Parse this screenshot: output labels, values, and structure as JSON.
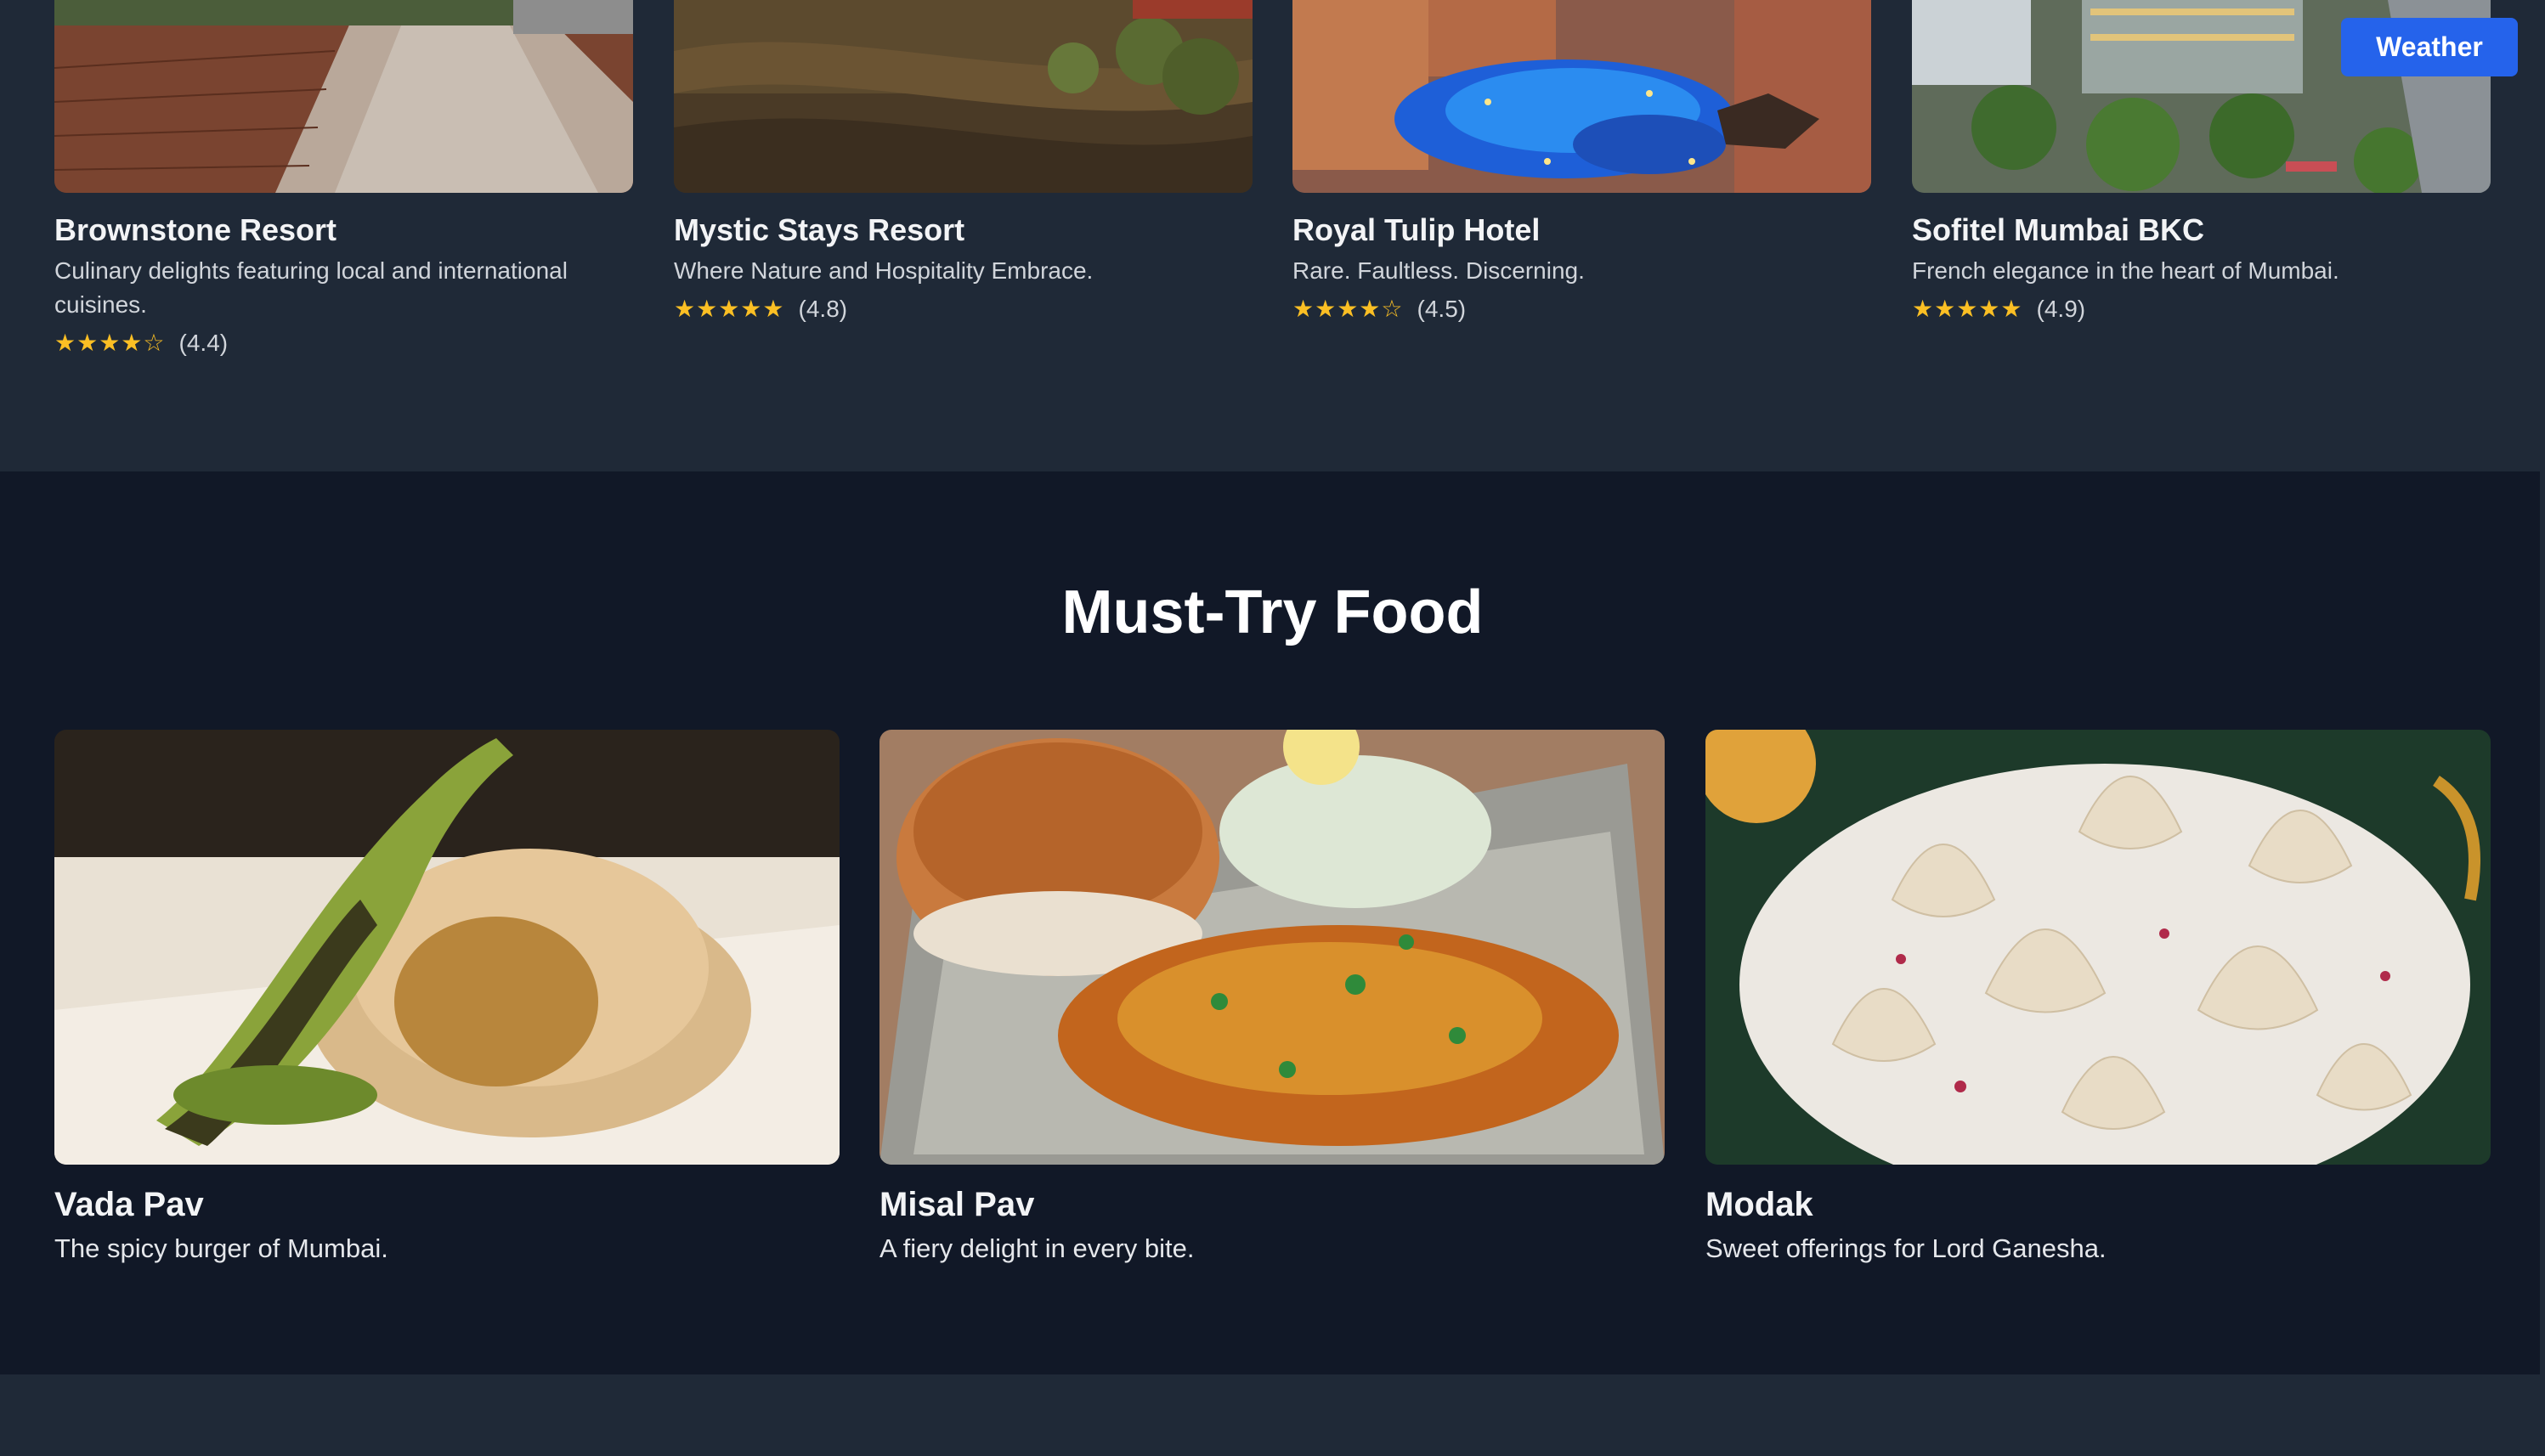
{
  "weather_button": {
    "label": "Weather"
  },
  "stays": [
    {
      "name": "Brownstone Resort",
      "description": "Culinary delights featuring local and international cuisines.",
      "stars": "★★★★☆",
      "rating": "(4.4)",
      "rating_value": 4.4
    },
    {
      "name": "Mystic Stays Resort",
      "description": "Where Nature and Hospitality Embrace.",
      "stars": "★★★★★",
      "rating": "(4.8)",
      "rating_value": 4.8
    },
    {
      "name": "Royal Tulip Hotel",
      "description": "Rare. Faultless. Discerning.",
      "stars": "★★★★☆",
      "rating": "(4.5)",
      "rating_value": 4.5
    },
    {
      "name": "Sofitel Mumbai BKC",
      "description": "French elegance in the heart of Mumbai.",
      "stars": "★★★★★",
      "rating": "(4.9)",
      "rating_value": 4.9
    }
  ],
  "food_section": {
    "title": "Must-Try Food",
    "items": [
      {
        "name": "Vada Pav",
        "description": "The spicy burger of Mumbai."
      },
      {
        "name": "Misal Pav",
        "description": "A fiery delight in every bite."
      },
      {
        "name": "Modak",
        "description": "Sweet offerings for Lord Ganesha."
      }
    ]
  },
  "colors": {
    "page_bg": "#1f2937",
    "food_bg": "#111827",
    "accent": "#2563eb",
    "star": "#fbbf24"
  }
}
